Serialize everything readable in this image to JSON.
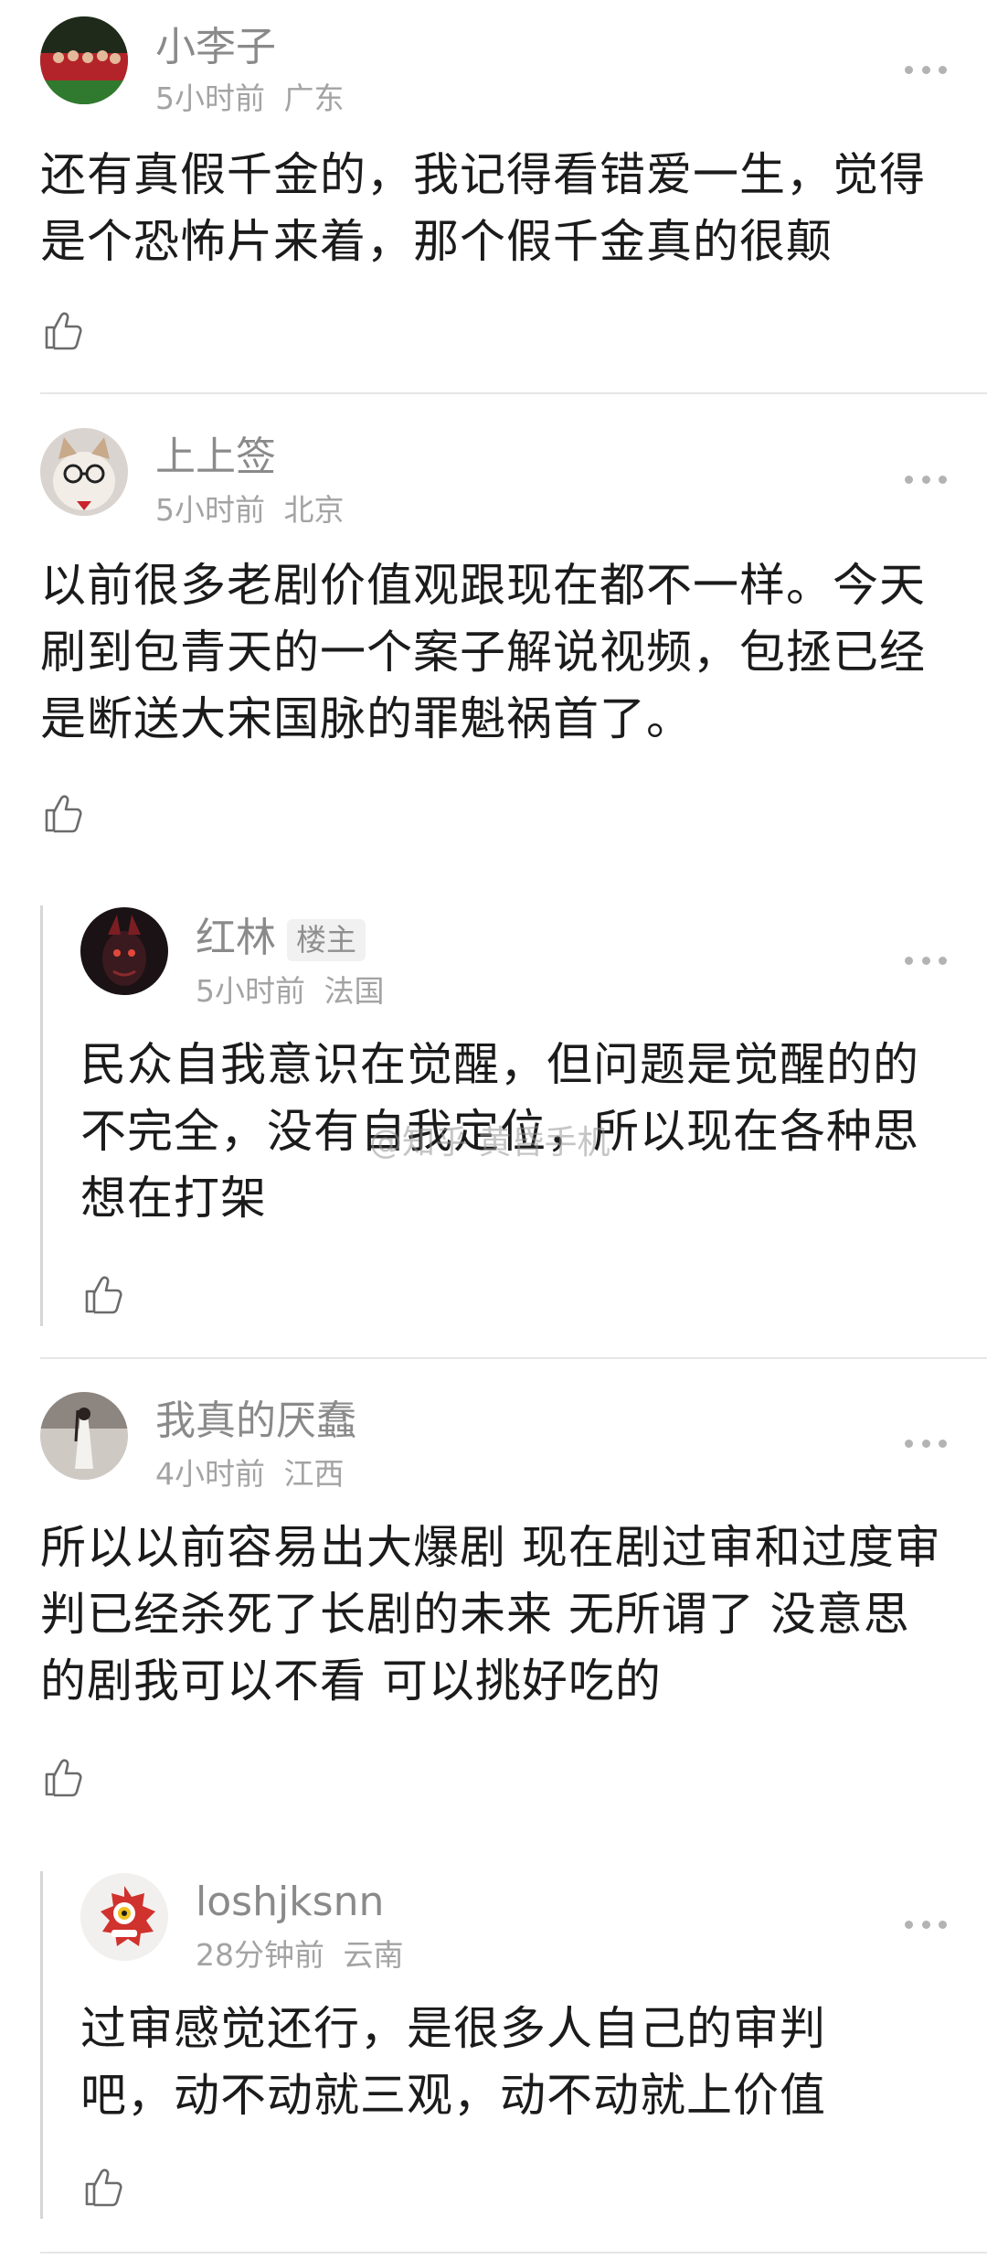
{
  "comments": [
    {
      "name": "小李子",
      "time": "5小时前",
      "location": "广东",
      "text": "还有真假千金的，我记得看错爱一生，觉得是个恐怖片来着，那个假千金真的很颠"
    },
    {
      "name": "上上签",
      "time": "5小时前",
      "location": "北京",
      "text": "以前很多老剧价值观跟现在都不一样。今天刷到包青天的一个案子解说视频，包拯已经是断送大宋国脉的罪魁祸首了。"
    },
    {
      "name": "红林",
      "badge": "楼主",
      "time": "5小时前",
      "location": "法国",
      "text": "民众自我意识在觉醒，但问题是觉醒的的不完全，没有自我定位，所以现在各种思想在打架"
    },
    {
      "name": "我真的厌蠢",
      "time": "4小时前",
      "location": "江西",
      "text": "所以以前容易出大爆剧  现在剧过审和过度审判已经杀死了长剧的未来  无所谓了  没意思的剧我可以不看  可以挑好吃的"
    },
    {
      "name": "loshjksnn",
      "time": "28分钟前",
      "location": "云南",
      "text": "过审感觉还行，是很多人自己的审判吧，动不动就三观，动不动就上价值"
    }
  ],
  "watermark": "@知乎 黄昏手机",
  "icons": {
    "like": "thumbs-up-icon",
    "more": "more-dots-icon"
  },
  "colors": {
    "name": "#8a8a8a",
    "meta": "#a3a3a3",
    "text": "#1b1b1b",
    "divider": "#e6e6e6",
    "reply_bar": "#d6d6d6"
  }
}
